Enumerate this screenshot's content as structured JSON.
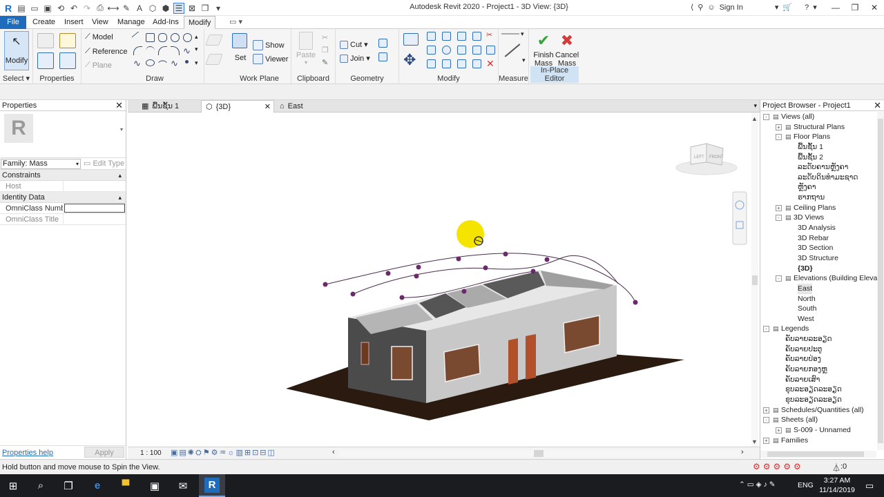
{
  "window": {
    "title": "Autodesk Revit 2020 - Project1 - 3D View: {3D}",
    "signin": "Sign In"
  },
  "tabs": [
    "File",
    "Create",
    "Insert",
    "View",
    "Manage",
    "Add-Ins",
    "Modify"
  ],
  "ribbon": {
    "select": {
      "modify": "Modify",
      "label": "Select"
    },
    "properties": {
      "label": "Properties"
    },
    "draw": {
      "model": "Model",
      "reference": "Reference",
      "plane": "Plane",
      "label": "Draw"
    },
    "workplane": {
      "set": "Set",
      "show": "Show",
      "viewer": "Viewer",
      "label": "Work Plane"
    },
    "clipboard": {
      "paste": "Paste",
      "label": "Clipboard"
    },
    "geometry": {
      "cut": "Cut",
      "join": "Join",
      "label": "Geometry"
    },
    "modify": {
      "label": "Modify"
    },
    "measure": {
      "label": "Measure"
    },
    "inplace": {
      "finish": [
        "Finish",
        "Mass"
      ],
      "cancel": [
        "Cancel",
        "Mass"
      ],
      "label": "In-Place Editor"
    }
  },
  "properties": {
    "title": "Properties",
    "family": "Family: Mass",
    "edit_type": "Edit Type",
    "sections": [
      {
        "name": "Constraints",
        "rows": [
          {
            "k": "Host",
            "v": ""
          }
        ]
      },
      {
        "name": "Identity Data",
        "rows": [
          {
            "k": "OmniClass Numb...",
            "v": ""
          },
          {
            "k": "OmniClass Title",
            "v": ""
          }
        ]
      }
    ],
    "help": "Properties help",
    "apply": "Apply"
  },
  "viewtabs": [
    "ພື້ນຊັ້ນ 1",
    "{3D}",
    "East"
  ],
  "viewcube": {
    "left": "LEFT",
    "front": "FRONT"
  },
  "viewbar": {
    "scale": "1 : 100"
  },
  "browser": {
    "title": "Project Browser - Project1",
    "items": [
      {
        "t": "Views (all)",
        "d": 0,
        "e": "-"
      },
      {
        "t": "Structural Plans",
        "d": 1,
        "e": "+"
      },
      {
        "t": "Floor Plans",
        "d": 1,
        "e": "-"
      },
      {
        "t": "ພື້ນຊັ້ນ 1",
        "d": 2,
        "e": ""
      },
      {
        "t": "ພື້ນຊັ້ນ 2",
        "d": 2,
        "e": ""
      },
      {
        "t": "ລະດັບຄານຫຼັງຄາ",
        "d": 2,
        "e": ""
      },
      {
        "t": "ລະດັບດິນທຳມະຊາດ",
        "d": 2,
        "e": ""
      },
      {
        "t": "ຫຼັງຄາ",
        "d": 2,
        "e": ""
      },
      {
        "t": "ຮາກຖານ",
        "d": 2,
        "e": ""
      },
      {
        "t": "Ceiling Plans",
        "d": 1,
        "e": "+"
      },
      {
        "t": "3D Views",
        "d": 1,
        "e": "-"
      },
      {
        "t": "3D Analysis",
        "d": 2,
        "e": ""
      },
      {
        "t": "3D Rebar",
        "d": 2,
        "e": ""
      },
      {
        "t": "3D Section",
        "d": 2,
        "e": ""
      },
      {
        "t": "3D Structure",
        "d": 2,
        "e": ""
      },
      {
        "t": "{3D}",
        "d": 2,
        "e": "",
        "b": true
      },
      {
        "t": "Elevations (Building Elevation)",
        "d": 1,
        "e": "-"
      },
      {
        "t": "East",
        "d": 2,
        "e": "",
        "s": true
      },
      {
        "t": "North",
        "d": 2,
        "e": ""
      },
      {
        "t": "South",
        "d": 2,
        "e": ""
      },
      {
        "t": "West",
        "d": 2,
        "e": ""
      },
      {
        "t": "Legends",
        "d": 0,
        "e": "-"
      },
      {
        "t": "ຄັບລາຍລະອຽດ",
        "d": 1,
        "e": ""
      },
      {
        "t": "ຄັບລາຍປະຕູ",
        "d": 1,
        "e": ""
      },
      {
        "t": "ຄັບລາຍປ່ອງ",
        "d": 1,
        "e": ""
      },
      {
        "t": "ຄັບລາຍກອງຫຼ",
        "d": 1,
        "e": ""
      },
      {
        "t": "ຄັບລາຍເສົາ",
        "d": 1,
        "e": ""
      },
      {
        "t": "ຂຸບລະອຽດລະອຽດ",
        "d": 1,
        "e": ""
      },
      {
        "t": "ຂຸບລະອຽດລະອຽດ",
        "d": 1,
        "e": ""
      },
      {
        "t": "Schedules/Quantities (all)",
        "d": 0,
        "e": "+"
      },
      {
        "t": "Sheets (all)",
        "d": 0,
        "e": "-"
      },
      {
        "t": "S-009 - Unnamed",
        "d": 1,
        "e": "+"
      },
      {
        "t": "Families",
        "d": 0,
        "e": "+"
      }
    ]
  },
  "status": {
    "text": "Hold button and move mouse to Spin the View.",
    "filter": ":0"
  },
  "taskbar": {
    "lang": "ENG",
    "time": "3:27 AM",
    "date": "11/14/2019"
  },
  "colors": {
    "file_tab": "#1f6cbd",
    "curve_point": "#6b2a6b",
    "highlight": "#f5e400",
    "ground": "#2b1a0f"
  }
}
